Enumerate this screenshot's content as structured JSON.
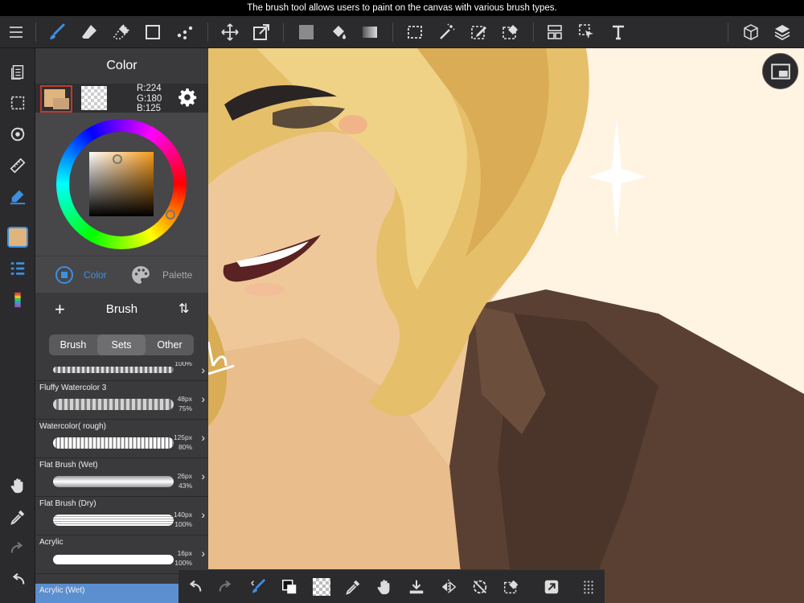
{
  "caption": "The brush tool allows users to paint on the canvas with various brush types.",
  "colors": {
    "accent": "#3d8fe0",
    "current_color": "#E0B47D",
    "panel_bg": "#474749",
    "selected_row": "#5b8fcf"
  },
  "top_toolbar": {
    "icons": [
      "menu-icon",
      "brush-icon",
      "eraser-icon",
      "smudge-icon",
      "rectangle-shape-icon",
      "dot-grid-icon",
      "move-icon",
      "transform-icon",
      "fill-color-icon",
      "paint-bucket-icon",
      "gradient-icon",
      "selection-rect-icon",
      "magic-wand-icon",
      "selection-pen-icon",
      "selection-eraser-icon",
      "panel-layout-icon",
      "select-layer-icon",
      "text-icon",
      "3d-cube-icon",
      "layers-icon"
    ]
  },
  "left_rail": {
    "icons": [
      "pages-icon",
      "selection-icon",
      "rotate-icon",
      "ruler-icon",
      "pen-fill-icon",
      "color-swatch-icon",
      "list-icon",
      "gradient-bars-icon",
      "hand-icon",
      "eyedropper-icon",
      "redo-icon",
      "undo-icon"
    ]
  },
  "color_panel": {
    "title": "Color",
    "rgb": {
      "r": "R:224",
      "g": "G:180",
      "b": "B:125"
    },
    "tabs": {
      "color": "Color",
      "palette": "Palette"
    }
  },
  "brush_panel": {
    "title": "Brush",
    "plus": "+",
    "sort": "⇅",
    "segments": [
      "Brush",
      "Sets",
      "Other"
    ],
    "active_segment": "Sets",
    "brushes": [
      {
        "name": "",
        "size": "",
        "opacity": "100%"
      },
      {
        "name": "Fluffy Watercolor 3",
        "size": "48px",
        "opacity": "75%"
      },
      {
        "name": "Watercolor( rough)",
        "size": "125px",
        "opacity": "80%"
      },
      {
        "name": "Flat Brush (Wet)",
        "size": "26px",
        "opacity": "43%"
      },
      {
        "name": "Flat Brush (Dry)",
        "size": "140px",
        "opacity": "100%"
      },
      {
        "name": "Acrylic",
        "size": "16px",
        "opacity": "100%"
      },
      {
        "name": "Acrylic (Wet)",
        "size": "",
        "opacity": ""
      }
    ],
    "selected_brush": "Acrylic (Wet)"
  },
  "bottom_toolbar": {
    "icons": [
      "undo-icon",
      "redo-icon",
      "brush-swap-icon",
      "color-swap-icon",
      "transparent-color-icon",
      "eyedropper-icon",
      "hand-icon",
      "save-icon",
      "flip-icon",
      "rotate-reset-icon",
      "snap-eraser-icon",
      "quick-icon",
      "more-icon"
    ]
  }
}
